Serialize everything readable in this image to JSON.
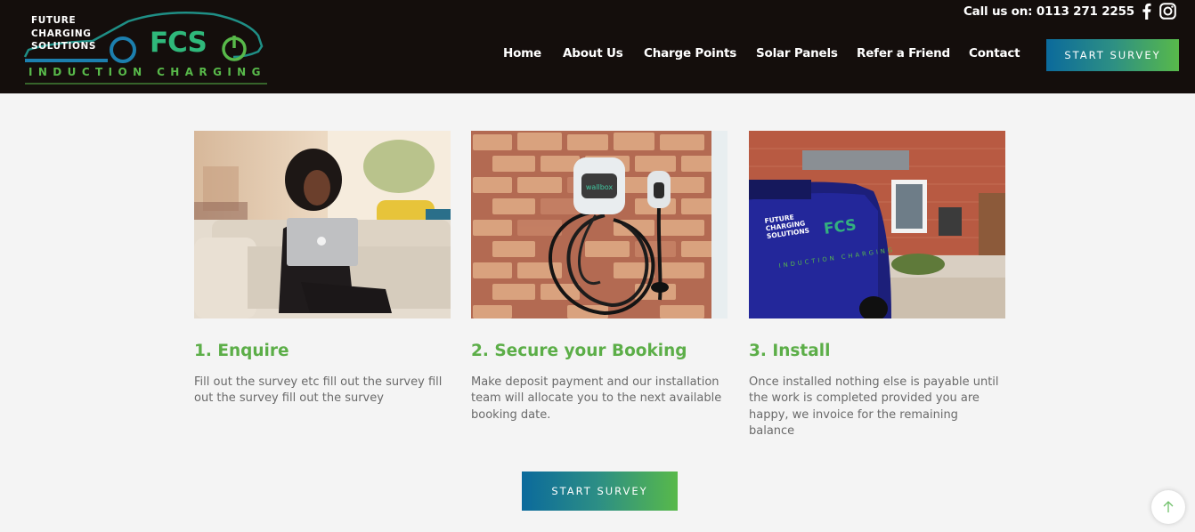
{
  "header": {
    "logo": {
      "company_lines": "FUTURE\nCHARGING\nSOLUTIONS",
      "brand": "FCS",
      "tagline": "INDUCTION CHARGING"
    },
    "call_us": "Call us on: 0113 271 2255",
    "social": [
      "facebook-icon",
      "instagram-icon"
    ],
    "nav": [
      "Home",
      "About Us",
      "Charge Points",
      "Solar Panels",
      "Refer a Friend",
      "Contact"
    ],
    "survey_button": "START SURVEY"
  },
  "steps": [
    {
      "title": "1. Enquire",
      "description": "Fill out the survey etc fill out the survey fill out the survey fill out the survey"
    },
    {
      "title": "2. Secure your Booking",
      "description": "Make deposit payment and our installation team will allocate you to the next available booking date."
    },
    {
      "title": "3. Install",
      "description": "Once installed nothing else is payable until the work is completed provided you are happy, we invoice for the remaining balance"
    }
  ],
  "photo_text": {
    "charger_brand": "wallbox",
    "van_company": "FUTURE\nCHARGING\nSOLUTIONS",
    "van_brand": "FCS",
    "van_tagline": "INDUCTION CHARGING"
  },
  "cta_button": "START SURVEY",
  "colors": {
    "header_bg": "#140e0c",
    "accent_green": "#5cae48",
    "accent_blue": "#0b6a9c"
  }
}
